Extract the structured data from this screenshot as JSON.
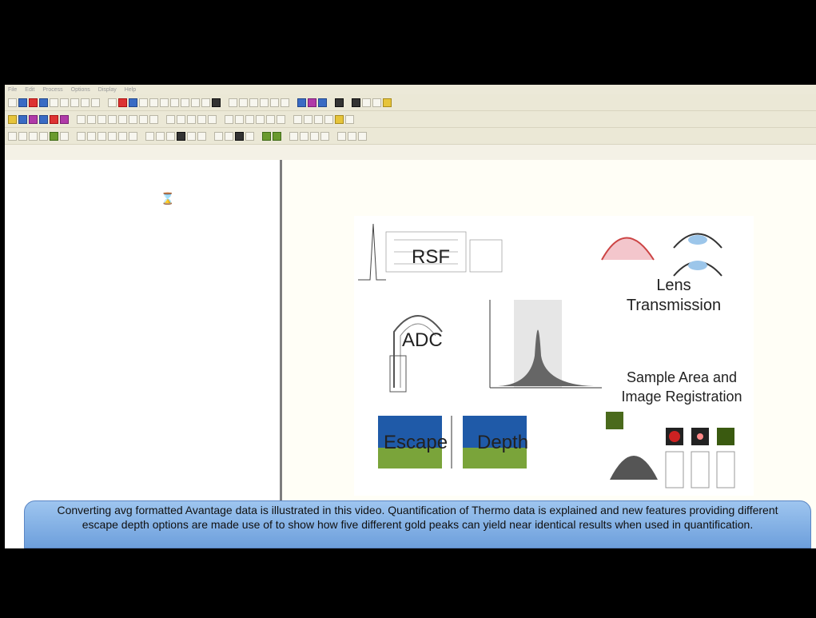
{
  "menubar": {
    "items": [
      "File",
      "Edit",
      "Process",
      "Options",
      "Display",
      "Help"
    ]
  },
  "slide": {
    "rsf": "RSF",
    "lens": "Lens Transmission",
    "adc": "ADC",
    "sample": "Sample Area and Image Registration",
    "escape": "Escape",
    "depth": "Depth"
  },
  "caption": "Converting avg formatted Avantage data is illustrated in this video. Quantification of Thermo data is explained and new features providing different escape depth options are made use of to show how five different gold peaks can yield near identical results when used in quantification."
}
